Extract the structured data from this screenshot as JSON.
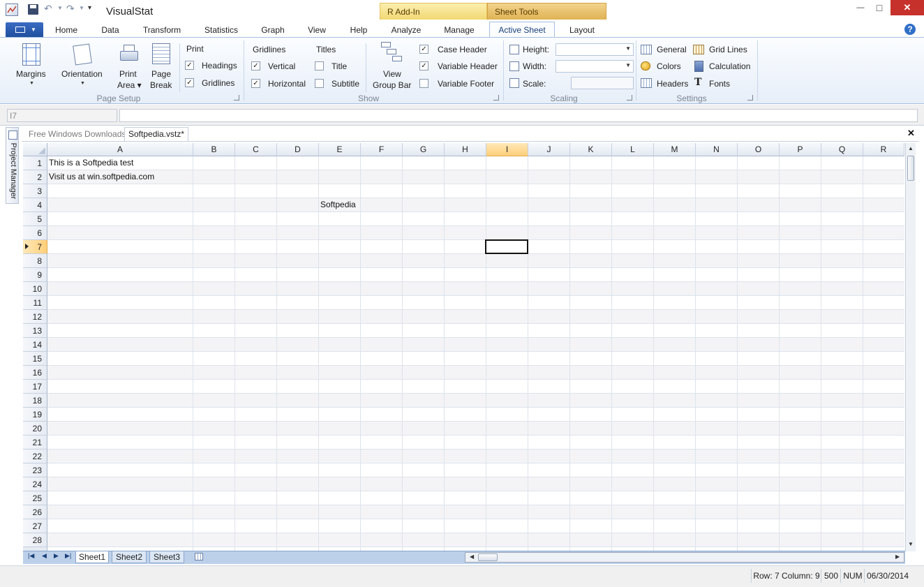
{
  "app": {
    "title": "VisualStat"
  },
  "context_tabs": {
    "r_addin": "R Add-In",
    "sheet_tools": "Sheet Tools"
  },
  "window_buttons": {
    "minimize": "—",
    "maximize": "□",
    "close": "✕"
  },
  "ribbon_tabs": [
    "Home",
    "Data",
    "Transform",
    "Statistics",
    "Graph",
    "View",
    "Help",
    "Analyze",
    "Manage",
    "Active Sheet",
    "Layout"
  ],
  "active_tab": "Active Sheet",
  "ribbon": {
    "page_setup": {
      "label": "Page Setup",
      "margins": "Margins",
      "orientation": "Orientation",
      "print_area_1": "Print",
      "print_area_2": "Area ▾",
      "page_break_1": "Page",
      "page_break_2": "Break",
      "print_title": "Print",
      "headings": "Headings",
      "gridlines": "Gridlines"
    },
    "show": {
      "label": "Show",
      "gridlines_title": "Gridlines",
      "vertical": "Vertical",
      "horizontal": "Horizontal",
      "titles_title": "Titles",
      "title": "Title",
      "subtitle": "Subtitle",
      "view_group_bar_1": "View",
      "view_group_bar_2": "Group Bar",
      "case_header": "Case Header",
      "variable_header": "Variable Header",
      "variable_footer": "Variable Footer"
    },
    "scaling": {
      "label": "Scaling",
      "height": "Height:",
      "width": "Width:",
      "scale": "Scale:"
    },
    "settings": {
      "label": "Settings",
      "general": "General",
      "colors": "Colors",
      "headers": "Headers",
      "grid_lines": "Grid Lines",
      "calculation": "Calculation",
      "fonts": "Fonts"
    }
  },
  "formula_bar": {
    "cell_ref": "I7",
    "value": ""
  },
  "side_panel": {
    "label": "Project Manager"
  },
  "doc_tabs": [
    "Free Windows Downloads",
    "Softpedia.vstz*"
  ],
  "columns": [
    "A",
    "B",
    "C",
    "D",
    "E",
    "F",
    "G",
    "H",
    "I",
    "J",
    "K",
    "L",
    "M",
    "N",
    "O",
    "P",
    "Q",
    "R"
  ],
  "rows": [
    "1",
    "2",
    "3",
    "4",
    "5",
    "6",
    "7",
    "8",
    "9",
    "10",
    "11",
    "12",
    "13",
    "14",
    "15",
    "16",
    "17",
    "18",
    "19",
    "20",
    "21",
    "22",
    "23",
    "24",
    "25",
    "26",
    "27",
    "28"
  ],
  "cells": {
    "A1": "This is a Softpedia test",
    "A2": "Visit us at win.softpedia.com",
    "E4": "Softpedia"
  },
  "selected_cell": "I7",
  "sheet_tabs": [
    "Sheet1",
    "Sheet2",
    "Sheet3"
  ],
  "status": {
    "position": "Row: 7 Column: 9",
    "count": "500",
    "num": "NUM",
    "date": "06/30/2014"
  },
  "colors": {
    "accent": "#2b5797",
    "selected_header": "#ffd79a",
    "ribbon_border": "#a5bfe0"
  }
}
